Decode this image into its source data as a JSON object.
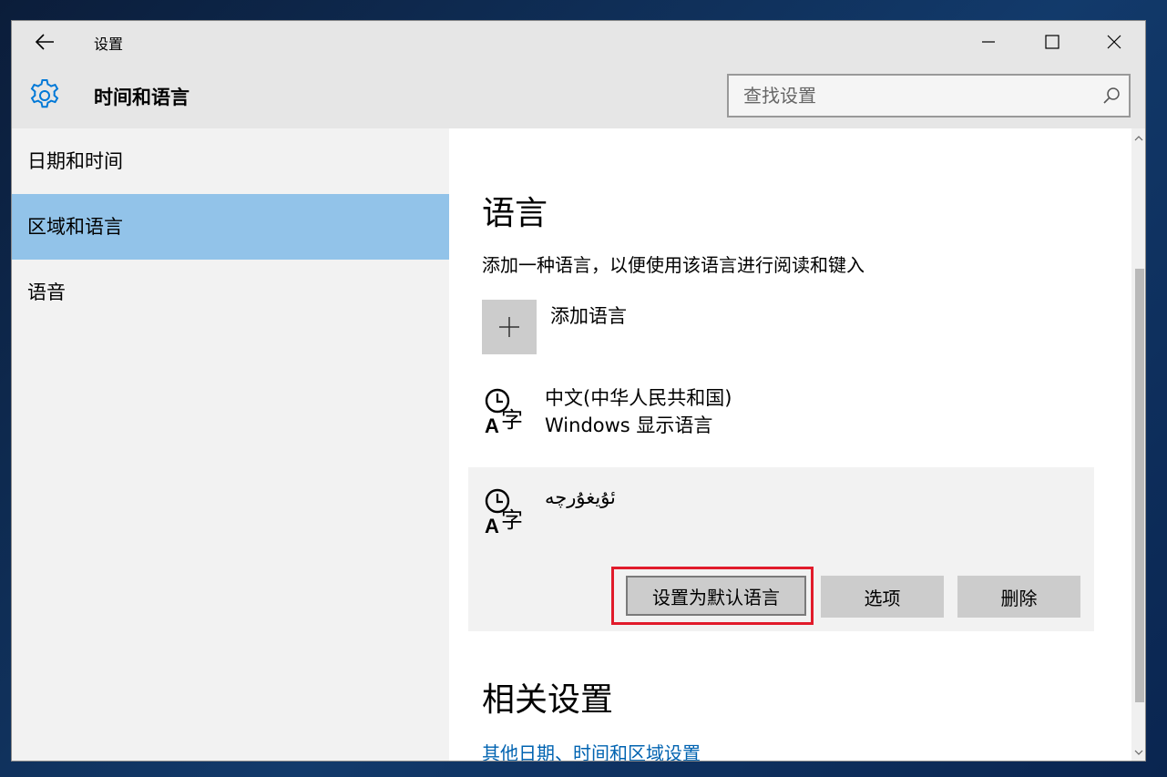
{
  "window": {
    "title": "设置",
    "app_title": "时间和语言"
  },
  "search": {
    "placeholder": "查找设置"
  },
  "sidebar": {
    "items": [
      {
        "label": "日期和时间",
        "active": false
      },
      {
        "label": "区域和语言",
        "active": true
      },
      {
        "label": "语音",
        "active": false
      }
    ]
  },
  "main": {
    "section_title": "语言",
    "section_description": "添加一种语言，以便使用该语言进行阅读和键入",
    "add_language_label": "添加语言",
    "languages": [
      {
        "name": "中文(中华人民共和国)",
        "subtitle": "Windows 显示语言",
        "icon": "language-icon"
      },
      {
        "name": "ئۇيغۇرچە",
        "icon": "language-icon"
      }
    ],
    "buttons": {
      "set_default": "设置为默认语言",
      "options": "选项",
      "delete": "删除"
    },
    "related_title": "相关设置",
    "related_link": "其他日期、时间和区域设置"
  },
  "colors": {
    "accent": "#0063b1",
    "selected_nav": "#92c3e9",
    "highlight_box": "#e11b2b",
    "gear_icon": "#0078d7"
  },
  "icons": {
    "back": "arrow-left-icon",
    "gear": "gear-icon",
    "search": "search-icon",
    "add": "plus-icon"
  }
}
